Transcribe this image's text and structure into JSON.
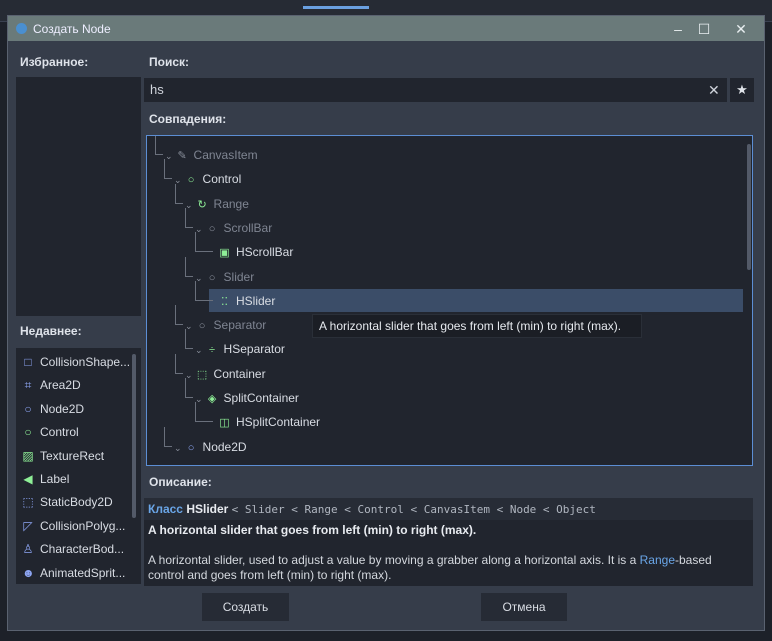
{
  "window": {
    "title": "Создать Node"
  },
  "favorites": {
    "label": "Избранное:"
  },
  "search": {
    "label": "Поиск:",
    "value": "hs"
  },
  "matches": {
    "label": "Совпадения:",
    "items": [
      {
        "label": "CanvasItem",
        "icon": "pencil-icon",
        "glyph": "✎",
        "color": "#8a909c",
        "depth": 0,
        "dim": true
      },
      {
        "label": "Control",
        "icon": "control-icon",
        "glyph": "○",
        "color": "#8eef97",
        "depth": 1,
        "dim": false
      },
      {
        "label": "Range",
        "icon": "range-icon",
        "glyph": "↻",
        "color": "#8eef97",
        "depth": 2,
        "dim": true
      },
      {
        "label": "ScrollBar",
        "icon": "scrollbar-icon",
        "glyph": "○",
        "color": "#8a909c",
        "depth": 3,
        "dim": true
      },
      {
        "label": "HScrollBar",
        "icon": "hscrollbar-icon",
        "glyph": "▣",
        "color": "#8eef97",
        "depth": 4,
        "dim": false
      },
      {
        "label": "Slider",
        "icon": "slider-icon",
        "glyph": "○",
        "color": "#8a909c",
        "depth": 3,
        "dim": true
      },
      {
        "label": "HSlider",
        "icon": "hslider-icon",
        "glyph": "⁚⁚",
        "color": "#8eef97",
        "depth": 4,
        "dim": false,
        "selected": true
      },
      {
        "label": "Separator",
        "icon": "separator-icon",
        "glyph": "○",
        "color": "#8a909c",
        "depth": 2,
        "dim": true
      },
      {
        "label": "HSeparator",
        "icon": "hseparator-icon",
        "glyph": "÷",
        "color": "#8eef97",
        "depth": 3,
        "dim": false
      },
      {
        "label": "Container",
        "icon": "container-icon",
        "glyph": "⬚",
        "color": "#8eef97",
        "depth": 2,
        "dim": false
      },
      {
        "label": "SplitContainer",
        "icon": "splitcontainer-icon",
        "glyph": "◈",
        "color": "#8eef97",
        "depth": 3,
        "dim": false
      },
      {
        "label": "HSplitContainer",
        "icon": "hsplitcontainer-icon",
        "glyph": "◫",
        "color": "#8eef97",
        "depth": 4,
        "dim": false
      },
      {
        "label": "Node2D",
        "icon": "node2d-icon",
        "glyph": "○",
        "color": "#8da5f3",
        "depth": 1,
        "dim": false
      }
    ],
    "tooltip": "A horizontal slider that goes from left (min) to right (max)."
  },
  "recent": {
    "label": "Недавнее:",
    "items": [
      {
        "label": "CollisionShape...",
        "icon": "collisionshape-icon",
        "glyph": "□",
        "color": "#8da5f3"
      },
      {
        "label": "Area2D",
        "icon": "area2d-icon",
        "glyph": "⌗",
        "color": "#8da5f3"
      },
      {
        "label": "Node2D",
        "icon": "node2d-icon",
        "glyph": "○",
        "color": "#8da5f3"
      },
      {
        "label": "Control",
        "icon": "control-icon",
        "glyph": "○",
        "color": "#8eef97"
      },
      {
        "label": "TextureRect",
        "icon": "texturerect-icon",
        "glyph": "▨",
        "color": "#8eef97"
      },
      {
        "label": "Label",
        "icon": "label-icon",
        "glyph": "◀",
        "color": "#8eef97"
      },
      {
        "label": "StaticBody2D",
        "icon": "staticbody2d-icon",
        "glyph": "⬚",
        "color": "#8da5f3"
      },
      {
        "label": "CollisionPolyg...",
        "icon": "collisionpolygon-icon",
        "glyph": "◸",
        "color": "#8da5f3"
      },
      {
        "label": "CharacterBod...",
        "icon": "characterbody-icon",
        "glyph": "♙",
        "color": "#8da5f3"
      },
      {
        "label": "AnimatedSprit...",
        "icon": "animatedsprite-icon",
        "glyph": "☻",
        "color": "#8da5f3"
      }
    ]
  },
  "description": {
    "label": "Описание:",
    "class_word": "Класс",
    "class_name": "HSlider",
    "inheritance": "< Slider < Range < Control < CanvasItem < Node < Object",
    "brief": "A horizontal slider that goes from left (min) to right (max).",
    "text_before": "A horizontal slider, used to adjust a value by moving a grabber along a horizontal axis. It is a ",
    "link": "Range",
    "text_after": "-based control and goes from left (min) to right (max)."
  },
  "buttons": {
    "create": "Создать",
    "cancel": "Отмена"
  },
  "colors": {
    "accent": "#5c8ed4",
    "selection": "#3b4d68",
    "link": "#6aa6e8"
  }
}
